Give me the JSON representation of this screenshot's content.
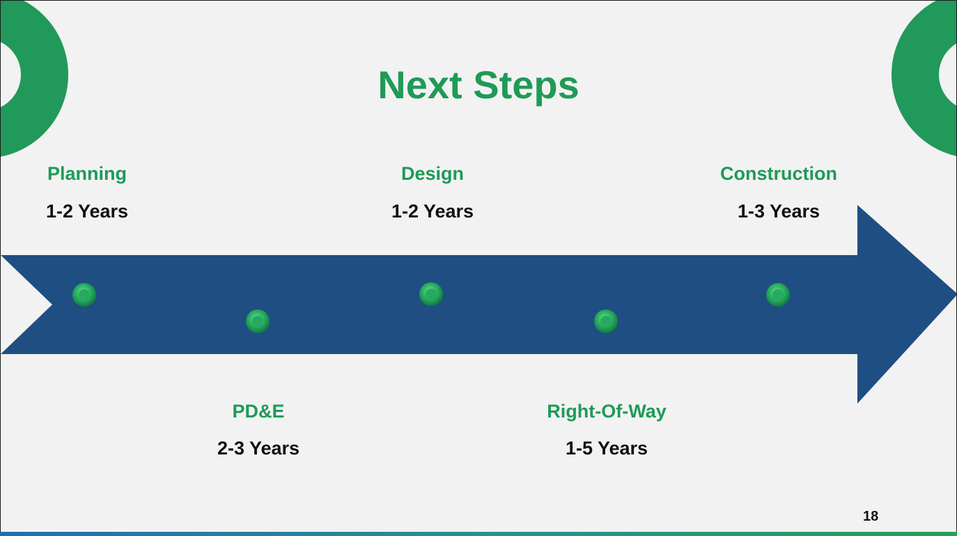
{
  "slide": {
    "title": "Next Steps",
    "page_number": "18"
  },
  "phases_top": [
    {
      "name": "Planning",
      "duration": "1-2 Years"
    },
    {
      "name": "Design",
      "duration": "1-2 Years"
    },
    {
      "name": "Construction",
      "duration": "1-3 Years"
    }
  ],
  "phases_bottom": [
    {
      "name": "PD&E",
      "duration": "2-3 Years"
    },
    {
      "name": "Right-Of-Way",
      "duration": "1-5 Years"
    }
  ],
  "colors": {
    "accent_green": "#1f9a57",
    "arrow_blue": "#1f4e82",
    "background": "#f2f2f2"
  }
}
